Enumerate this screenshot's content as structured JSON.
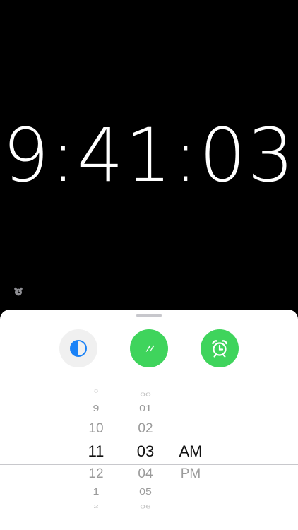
{
  "clock": {
    "time": "9:41:03"
  },
  "toolbar": {
    "theme_button": {
      "icon": "half-circle-icon",
      "color": "#1a82f7"
    },
    "dim_button": {
      "label": "〃",
      "color": "#3fd45c"
    },
    "alarm_button": {
      "icon": "alarm-clock-icon",
      "color": "#3fd45c"
    }
  },
  "picker": {
    "hours": [
      "8",
      "9",
      "10",
      "11",
      "12",
      "1",
      "2"
    ],
    "minutes": [
      "00",
      "01",
      "02",
      "03",
      "04",
      "05",
      "06"
    ],
    "ampm": [
      "AM",
      "PM"
    ],
    "selected": {
      "hour": "11",
      "minute": "03",
      "ampm": "AM"
    }
  },
  "colors": {
    "background": "#000000",
    "sheet": "#ffffff",
    "accent_green": "#3fd45c",
    "accent_blue": "#1a82f7"
  }
}
